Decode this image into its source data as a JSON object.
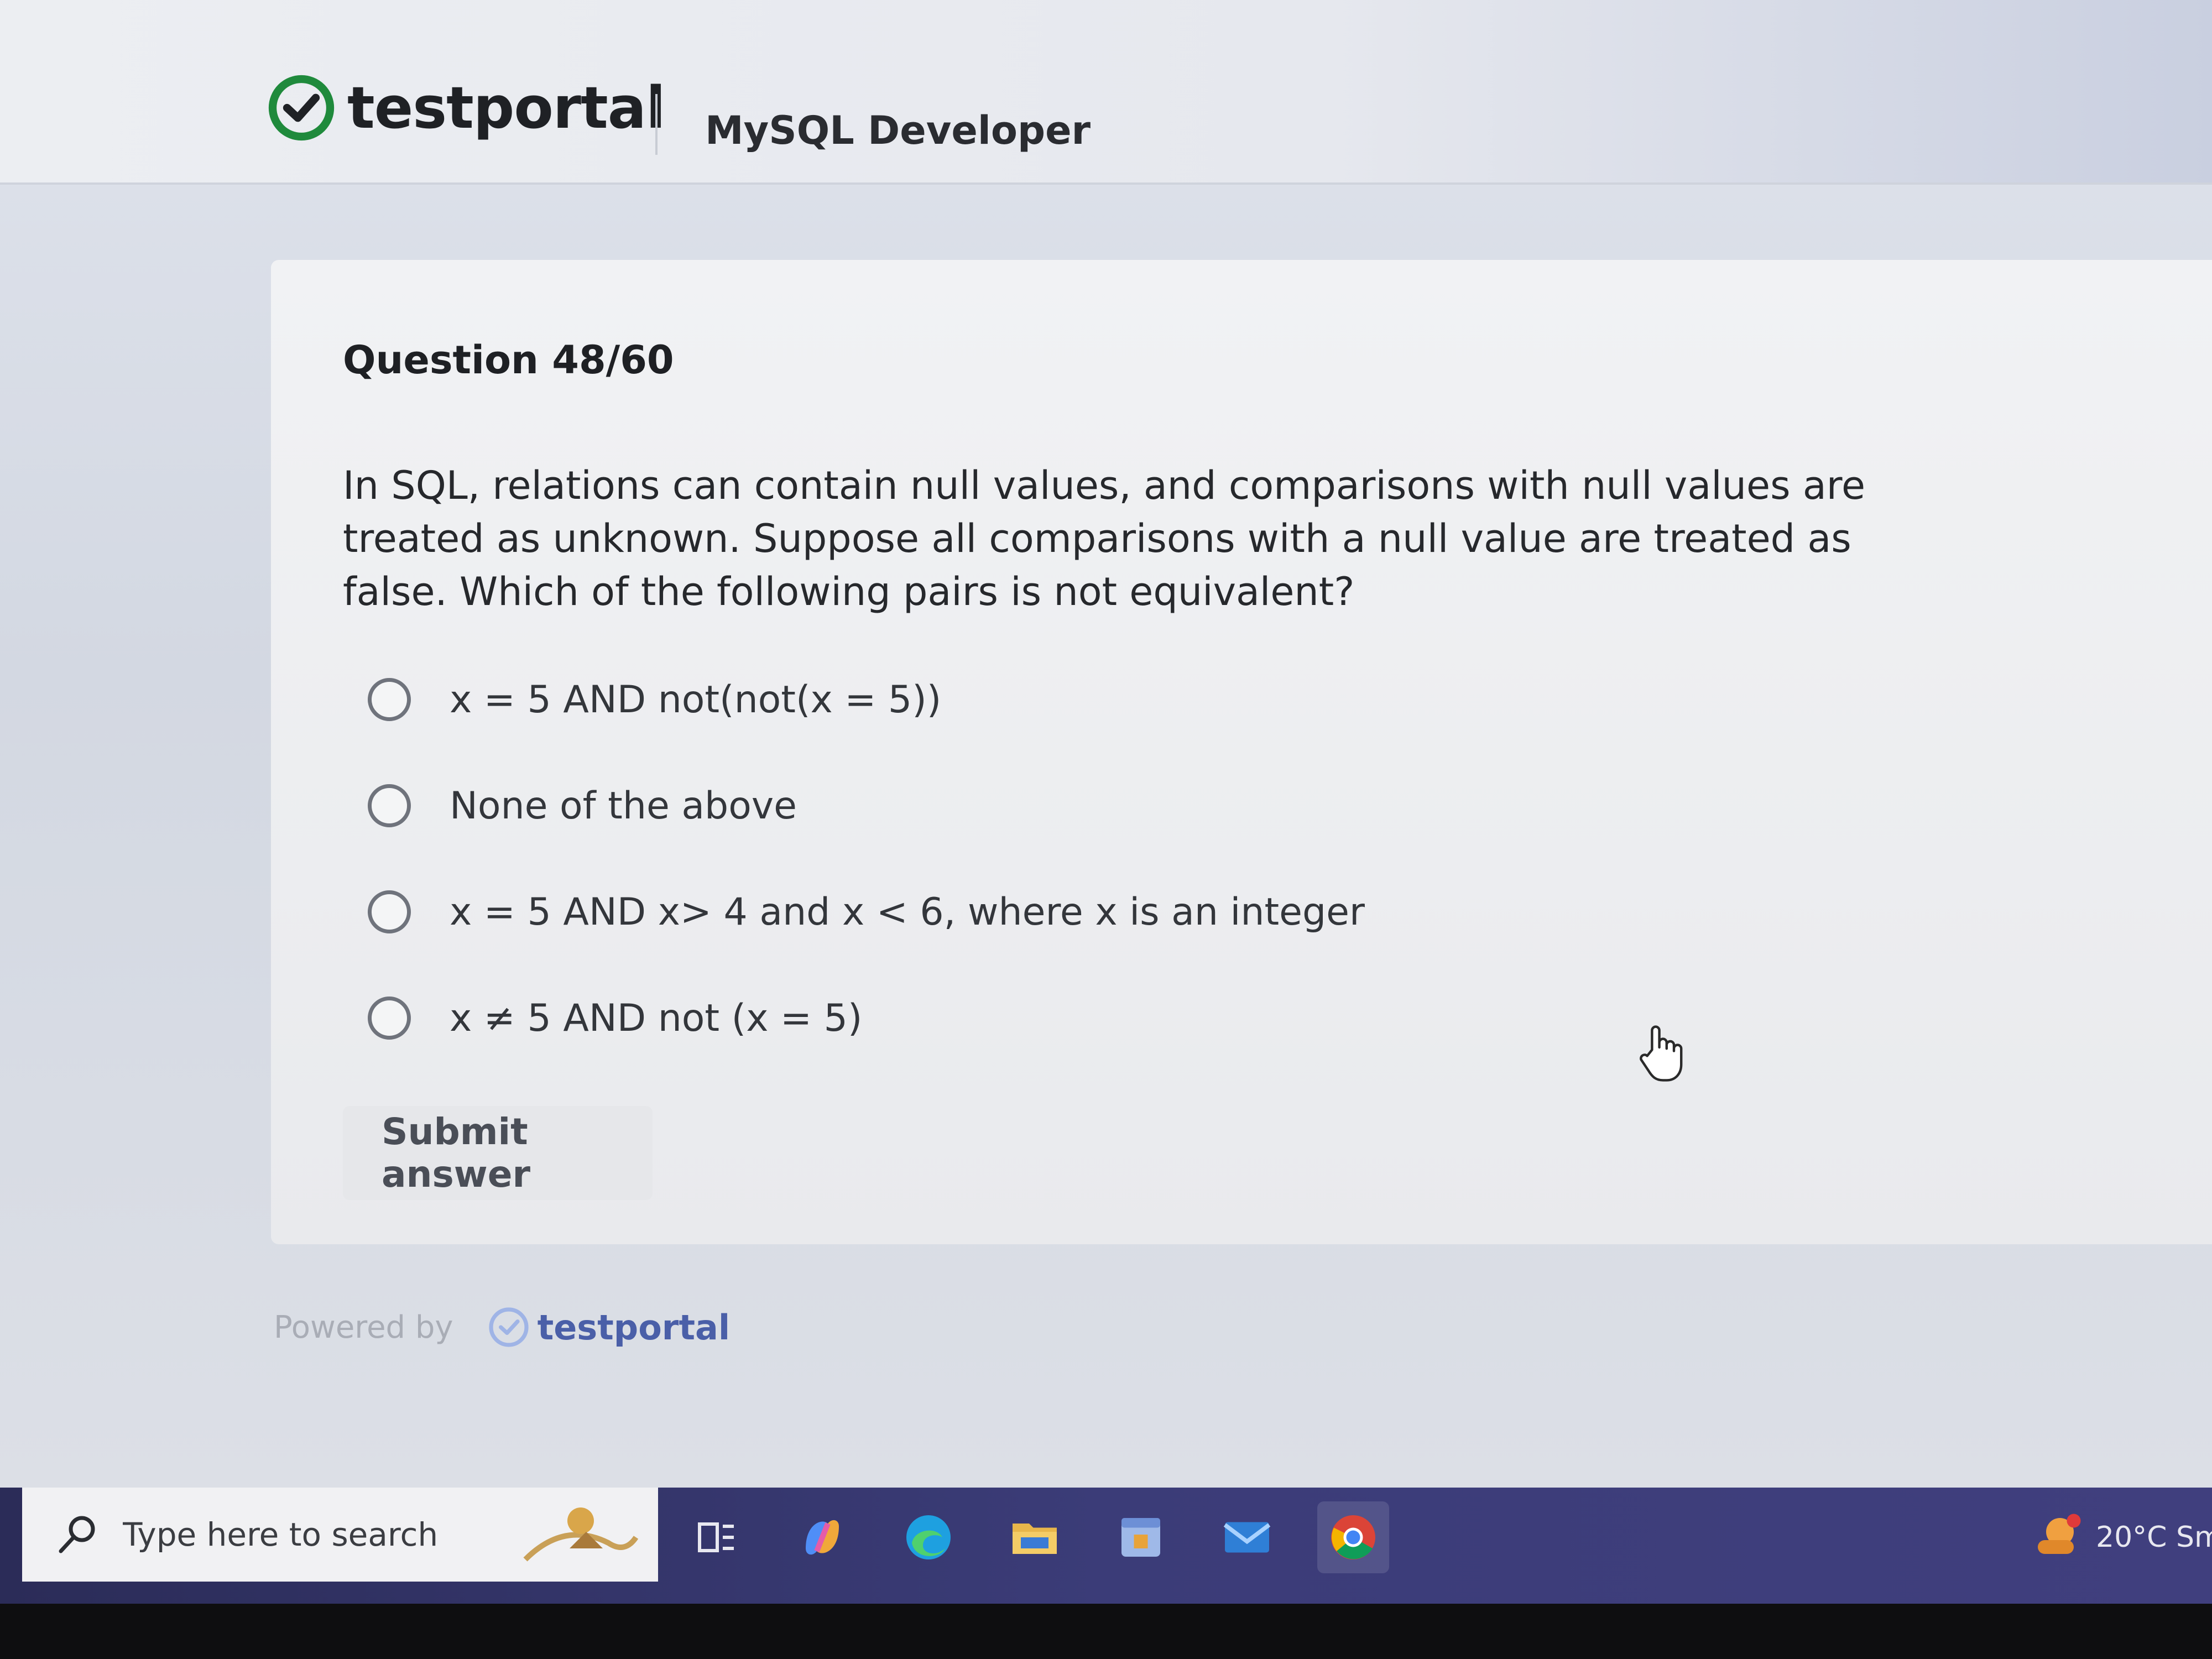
{
  "header": {
    "brand_name": "testportal",
    "course_title": "MySQL Developer"
  },
  "question": {
    "number_label": "Question 48/60",
    "text": "In SQL, relations can contain null values, and comparisons with null values are treated as unknown. Suppose all comparisons with a null value are treated as false. Which of the following pairs is not equivalent?",
    "options": [
      {
        "label": "x = 5 AND not(not(x = 5))",
        "selected": false
      },
      {
        "label": "None of the above",
        "selected": false
      },
      {
        "label": "x = 5 AND x> 4 and x < 6, where x is an integer",
        "selected": false
      },
      {
        "label": "x ≠ 5 AND not (x = 5)",
        "selected": false
      }
    ],
    "submit_label": "Submit answer"
  },
  "footer": {
    "powered_by": "Powered by",
    "brand_name": "testportal"
  },
  "taskbar": {
    "search_placeholder": "Type here to search",
    "weather": "20°C  Sm"
  },
  "colors": {
    "brand_green": "#1f8a3c",
    "taskbar": "#3b3c78",
    "footer_brand": "#4a5fa8"
  }
}
